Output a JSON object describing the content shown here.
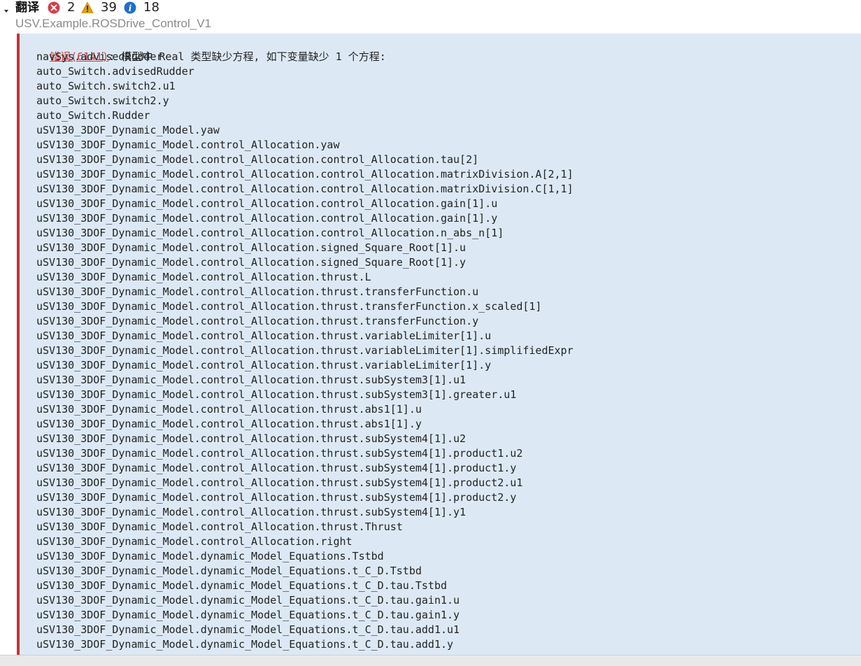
{
  "header": {
    "title": "翻译",
    "error_count": "2",
    "warning_count": "39",
    "info_count": "18"
  },
  "model_path": "USV.Example.ROSDrive_Control_V1",
  "error": {
    "link_text": "错误(6141)",
    "message": ": 模型中 Real 类型缺少方程, 如下变量缺少 1 个方程:"
  },
  "variables": [
    "navSys.advisedRudder",
    "auto_Switch.advisedRudder",
    "auto_Switch.switch2.u1",
    "auto_Switch.switch2.y",
    "auto_Switch.Rudder",
    "uSV130_3DOF_Dynamic_Model.yaw",
    "uSV130_3DOF_Dynamic_Model.control_Allocation.yaw",
    "uSV130_3DOF_Dynamic_Model.control_Allocation.control_Allocation.tau[2]",
    "uSV130_3DOF_Dynamic_Model.control_Allocation.control_Allocation.matrixDivision.A[2,1]",
    "uSV130_3DOF_Dynamic_Model.control_Allocation.control_Allocation.matrixDivision.C[1,1]",
    "uSV130_3DOF_Dynamic_Model.control_Allocation.control_Allocation.gain[1].u",
    "uSV130_3DOF_Dynamic_Model.control_Allocation.control_Allocation.gain[1].y",
    "uSV130_3DOF_Dynamic_Model.control_Allocation.control_Allocation.n_abs_n[1]",
    "uSV130_3DOF_Dynamic_Model.control_Allocation.signed_Square_Root[1].u",
    "uSV130_3DOF_Dynamic_Model.control_Allocation.signed_Square_Root[1].y",
    "uSV130_3DOF_Dynamic_Model.control_Allocation.thrust.L",
    "uSV130_3DOF_Dynamic_Model.control_Allocation.thrust.transferFunction.u",
    "uSV130_3DOF_Dynamic_Model.control_Allocation.thrust.transferFunction.x_scaled[1]",
    "uSV130_3DOF_Dynamic_Model.control_Allocation.thrust.transferFunction.y",
    "uSV130_3DOF_Dynamic_Model.control_Allocation.thrust.variableLimiter[1].u",
    "uSV130_3DOF_Dynamic_Model.control_Allocation.thrust.variableLimiter[1].simplifiedExpr",
    "uSV130_3DOF_Dynamic_Model.control_Allocation.thrust.variableLimiter[1].y",
    "uSV130_3DOF_Dynamic_Model.control_Allocation.thrust.subSystem3[1].u1",
    "uSV130_3DOF_Dynamic_Model.control_Allocation.thrust.subSystem3[1].greater.u1",
    "uSV130_3DOF_Dynamic_Model.control_Allocation.thrust.abs1[1].u",
    "uSV130_3DOF_Dynamic_Model.control_Allocation.thrust.abs1[1].y",
    "uSV130_3DOF_Dynamic_Model.control_Allocation.thrust.subSystem4[1].u2",
    "uSV130_3DOF_Dynamic_Model.control_Allocation.thrust.subSystem4[1].product1.u2",
    "uSV130_3DOF_Dynamic_Model.control_Allocation.thrust.subSystem4[1].product1.y",
    "uSV130_3DOF_Dynamic_Model.control_Allocation.thrust.subSystem4[1].product2.u1",
    "uSV130_3DOF_Dynamic_Model.control_Allocation.thrust.subSystem4[1].product2.y",
    "uSV130_3DOF_Dynamic_Model.control_Allocation.thrust.subSystem4[1].y1",
    "uSV130_3DOF_Dynamic_Model.control_Allocation.thrust.Thrust",
    "uSV130_3DOF_Dynamic_Model.control_Allocation.right",
    "uSV130_3DOF_Dynamic_Model.dynamic_Model_Equations.Tstbd",
    "uSV130_3DOF_Dynamic_Model.dynamic_Model_Equations.t_C_D.Tstbd",
    "uSV130_3DOF_Dynamic_Model.dynamic_Model_Equations.t_C_D.tau.Tstbd",
    "uSV130_3DOF_Dynamic_Model.dynamic_Model_Equations.t_C_D.tau.gain1.u",
    "uSV130_3DOF_Dynamic_Model.dynamic_Model_Equations.t_C_D.tau.gain1.y",
    "uSV130_3DOF_Dynamic_Model.dynamic_Model_Equations.t_C_D.tau.add1.u1",
    "uSV130_3DOF_Dynamic_Model.dynamic_Model_Equations.t_C_D.tau.add1.y"
  ],
  "colors": {
    "error_accent": "#c8303a",
    "panel_background": "#dce9f5",
    "warning": "#e0a100",
    "info": "#1e6fc9"
  },
  "icons": {
    "collapse": "chevron-down-icon",
    "error": "error-icon",
    "warning": "warning-icon",
    "info": "info-icon"
  }
}
